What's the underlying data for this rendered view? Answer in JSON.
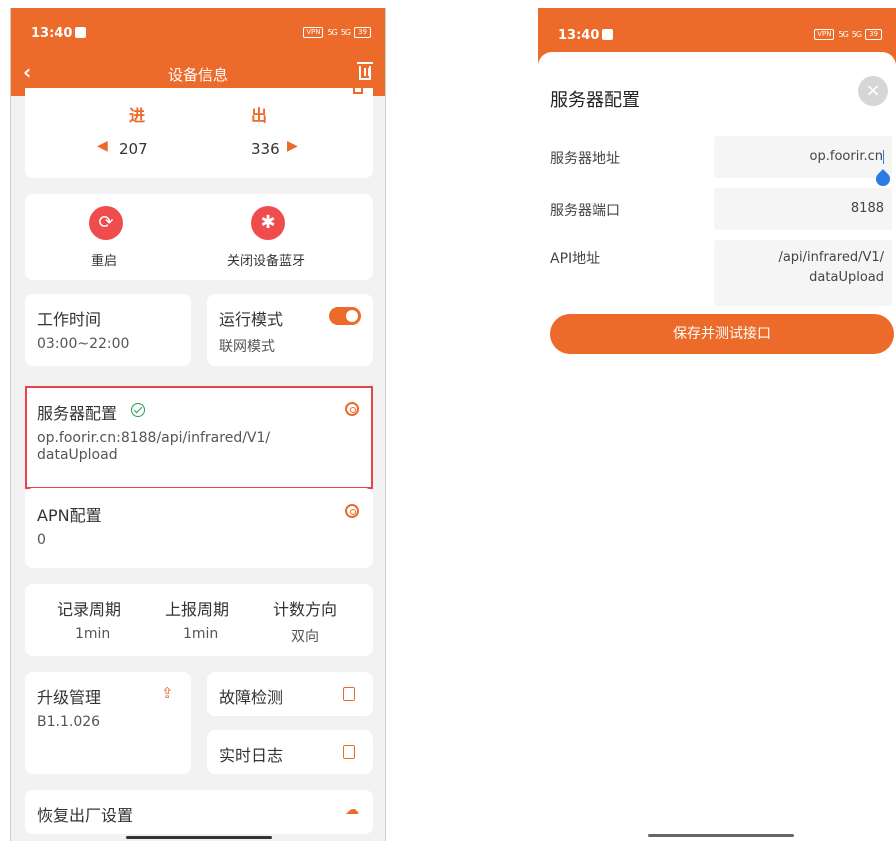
{
  "left": {
    "status": {
      "time": "13:40",
      "vpn": "VPN",
      "signal1": "5G",
      "signal2": "5G",
      "battery": "39"
    },
    "nav": {
      "back": "‹",
      "title": "设备信息"
    },
    "counter": {
      "in_label": "进",
      "out_label": "出",
      "in_value": "207",
      "out_value": "336"
    },
    "actions": {
      "restart_label": "重启",
      "bluetooth_label": "关闭设备蓝牙"
    },
    "work_time": {
      "label": "工作时间",
      "value": "03:00~22:00"
    },
    "run_mode": {
      "label": "运行模式",
      "value": "联网模式",
      "enabled": true
    },
    "server_config": {
      "label": "服务器配置",
      "value": "op.foorir.cn:8188/api/infrared/V1/\ndataUpload"
    },
    "apn_config": {
      "label": "APN配置",
      "value": "0"
    },
    "periods": {
      "record_label": "记录周期",
      "record_value": "1min",
      "report_label": "上报周期",
      "report_value": "1min",
      "direction_label": "计数方向",
      "direction_value": "双向"
    },
    "upgrade": {
      "label": "升级管理",
      "value": "B1.1.026"
    },
    "fault": {
      "label": "故障检测"
    },
    "log": {
      "label": "实时日志"
    },
    "factory_reset": {
      "label": "恢复出厂设置"
    }
  },
  "right": {
    "status": {
      "time": "13:40",
      "vpn": "VPN",
      "signal1": "5G",
      "signal2": "5G",
      "battery": "39"
    },
    "sheet_title": "服务器配置",
    "close": "×",
    "server_address": {
      "label": "服务器地址",
      "value": "op.foorir.cn"
    },
    "server_port": {
      "label": "服务器端口",
      "value": "8188"
    },
    "api_address": {
      "label": "API地址",
      "value": "/api/infrared/V1/\ndataUpload"
    },
    "save_button": "保存并测试接口"
  },
  "colors": {
    "accent": "#ec6a2a",
    "danger": "#ef4d4d",
    "success": "#22a04b",
    "highlight": "#e8434a"
  }
}
